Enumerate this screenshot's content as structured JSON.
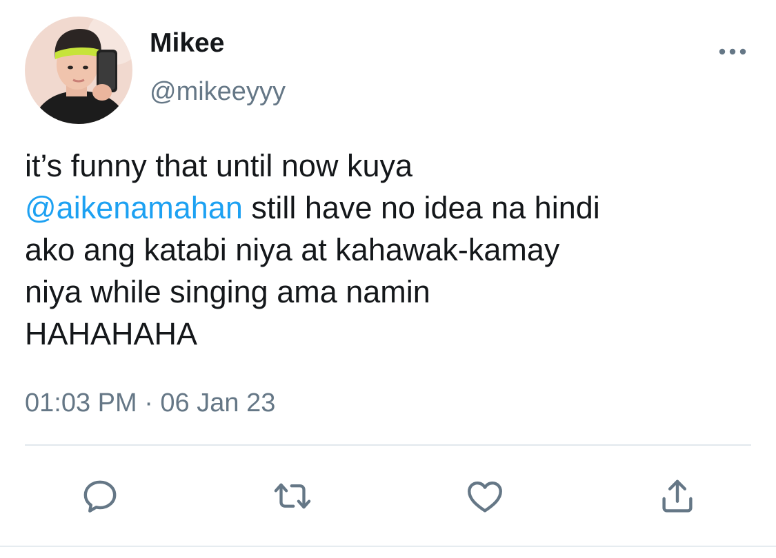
{
  "author": {
    "display_name": "Mikee",
    "handle": "@mikeeyyy"
  },
  "tweet": {
    "lines": [
      [
        "it’s funny that until now kuya"
      ],
      [
        "@aikenamahan",
        " still have no idea na hindi"
      ],
      [
        "ako ang katabi niya at kahawak-kamay"
      ],
      [
        "niya while singing ama namin"
      ],
      [
        "HAHAHAHA"
      ]
    ],
    "mention": "@aikenamahan",
    "timestamp": "01:03 PM · 06 Jan 23"
  },
  "actions": [
    {
      "name": "reply-button",
      "icon": "reply-icon"
    },
    {
      "name": "retweet-button",
      "icon": "retweet-icon"
    },
    {
      "name": "like-button",
      "icon": "heart-icon"
    },
    {
      "name": "share-button",
      "icon": "share-icon"
    }
  ],
  "colors": {
    "text": "#14171a",
    "secondary": "#657786",
    "link": "#1da1f2",
    "divider": "#e1e8ed",
    "icon": "#657786"
  }
}
